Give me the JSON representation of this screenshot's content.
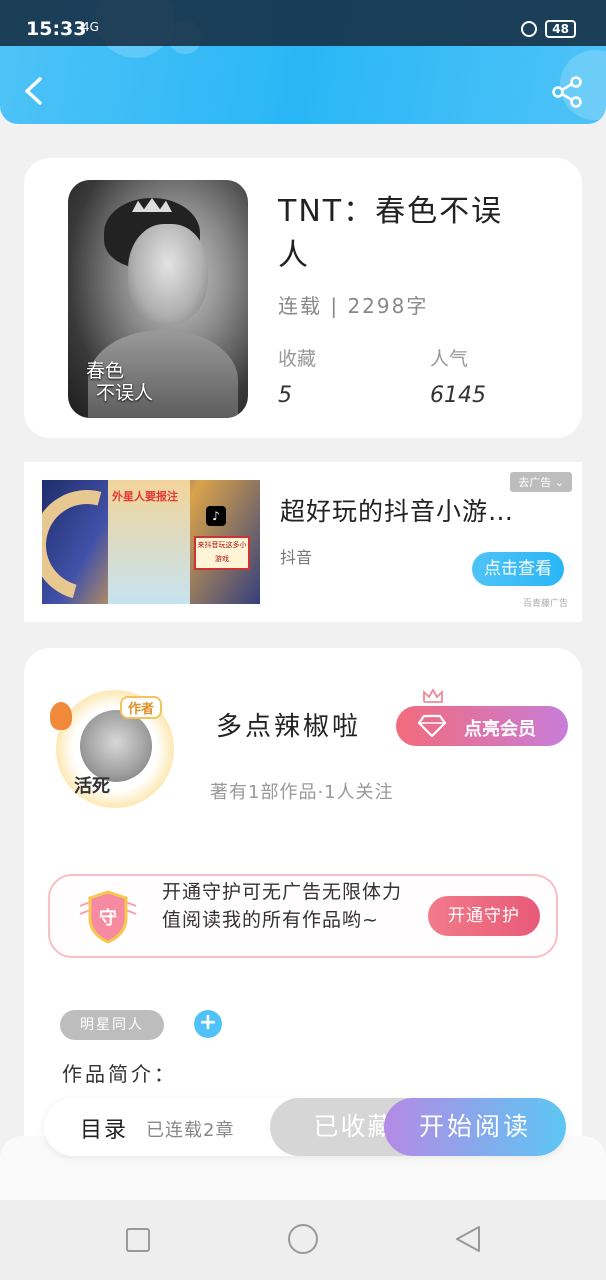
{
  "status_bar": {
    "time": "15:33",
    "signal": "4G",
    "battery": "48"
  },
  "book": {
    "title": "TNT：春色不误人",
    "meta": "连载 | 2298字",
    "cover_text_line1": "春色",
    "cover_text_line2": "不误人",
    "favorites_label": "收藏",
    "favorites_value": "5",
    "popularity_label": "人气",
    "popularity_value": "6145"
  },
  "ad": {
    "tag": "去广告 ⌄",
    "title": "超好玩的抖音小游…",
    "source": "抖音",
    "button": "点击查看",
    "note": "百青藤广告",
    "image_title": "外星人要报注",
    "image_sign": "来抖音玩这多小游戏"
  },
  "author": {
    "name": "多点辣椒啦",
    "meta": "著有1部作品·1人关注",
    "badge": "作者",
    "avatar_caption": "活死",
    "vip_button": "点亮会员"
  },
  "guard": {
    "shield_char": "守",
    "text": "开通守护可无广告无限体力值阅读我的所有作品哟~",
    "button": "开通守护"
  },
  "tag_label": "明星同人",
  "add_label": "+",
  "intro_label": "作品简介：",
  "action_bar": {
    "toc": "目录",
    "chapters": "已连载2章",
    "collected": "已收藏",
    "start": "开始阅读"
  },
  "colors": {
    "accent": "#29b6f6",
    "pink": "#f26b7b",
    "purple": "#b48ae6"
  }
}
